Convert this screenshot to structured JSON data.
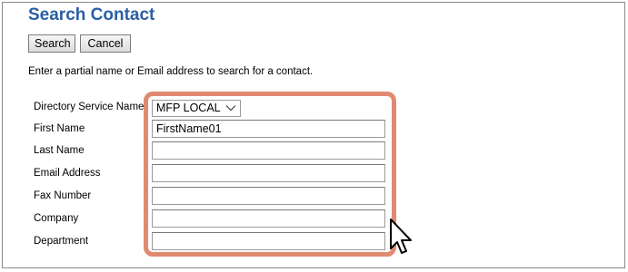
{
  "page": {
    "title": "Search Contact",
    "instruction": "Enter a partial name or Email address to search for a contact."
  },
  "toolbar": {
    "search_label": "Search",
    "cancel_label": "Cancel"
  },
  "form": {
    "directory": {
      "label": "Directory Service Name",
      "value": "MFP LOCAL"
    },
    "first_name": {
      "label": "First Name",
      "value": "FirstName01"
    },
    "last_name": {
      "label": "Last Name",
      "value": ""
    },
    "email": {
      "label": "Email Address",
      "value": ""
    },
    "fax": {
      "label": "Fax Number",
      "value": ""
    },
    "company": {
      "label": "Company",
      "value": ""
    },
    "department": {
      "label": "Department",
      "value": ""
    }
  },
  "colors": {
    "title": "#2b5fa4",
    "highlight": "#e08a72"
  },
  "icons": {
    "dropdown": "chevron-down-icon",
    "pointer": "mouse-pointer-icon"
  }
}
